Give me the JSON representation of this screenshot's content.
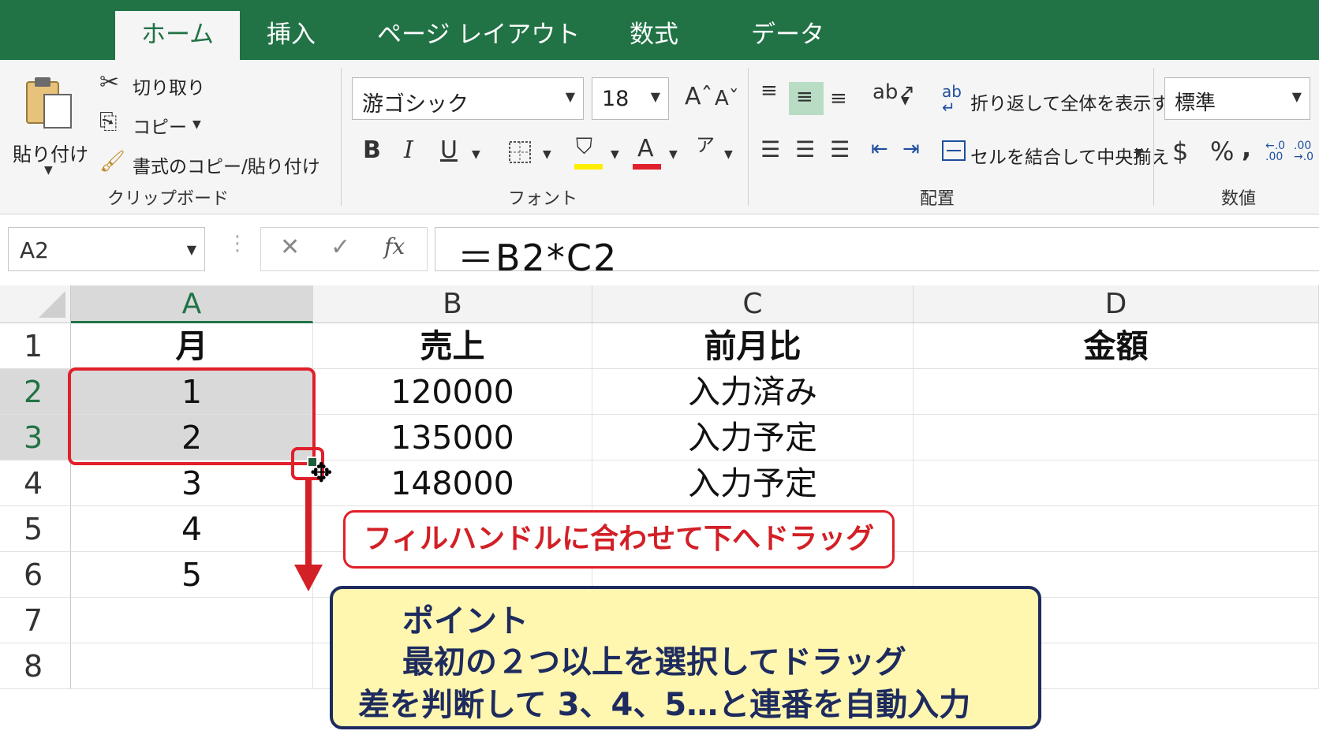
{
  "tabs": [
    {
      "label": "ホーム",
      "active": true
    },
    {
      "label": "挿入"
    },
    {
      "label": "ページ レイアウト"
    },
    {
      "label": "数式"
    },
    {
      "label": "データ"
    }
  ],
  "ribbon": {
    "clipboard": {
      "paste_label": "貼り付け",
      "cut_label": "切り取り",
      "copy_label": "コピー",
      "format_painter_label": "書式のコピー/貼り付け",
      "group_label": "クリップボード"
    },
    "font": {
      "font_name": "游ゴシック",
      "font_size": "18",
      "bold": "B",
      "italic": "I",
      "underline": "U",
      "group_label": "フォント"
    },
    "alignment": {
      "wrap_text_label": "折り返して全体を表示する",
      "merge_center_label": "セルを結合して中央揃え",
      "group_label": "配置"
    },
    "number": {
      "format": "標準",
      "currency": "$",
      "percent": "%",
      "comma": ",",
      "group_label": "数値"
    }
  },
  "formula_bar": {
    "name_box": "A2",
    "formula": "＝B2*C2",
    "fx": "fx"
  },
  "sheet": {
    "columns": [
      "A",
      "B",
      "C",
      "D"
    ],
    "selected_column": "A",
    "row_numbers": [
      "1",
      "2",
      "3",
      "4",
      "5",
      "6",
      "7",
      "8"
    ],
    "selected_rows": [
      "2",
      "3"
    ],
    "rows": [
      [
        "月",
        "売上",
        "前月比",
        "金額"
      ],
      [
        "1",
        "120000",
        "入力済み",
        ""
      ],
      [
        "2",
        "135000",
        "入力予定",
        ""
      ],
      [
        "3",
        "148000",
        "入力予定",
        ""
      ],
      [
        "4",
        "",
        "",
        ""
      ],
      [
        "5",
        "",
        "",
        ""
      ],
      [
        "",
        "",
        "",
        ""
      ],
      [
        "",
        "",
        "",
        ""
      ]
    ]
  },
  "annotations": {
    "drag_hint": "フィルハンドルに合わせて下へドラッグ",
    "tip_title": "ポイント",
    "tip_line2": "最初の２つ以上を選択してドラッグ",
    "tip_line3": "差を判断して 3、4、5…と連番を自動入力"
  },
  "colors": {
    "excel_green": "#217346",
    "annotation_red": "#d31f26",
    "tip_background": "#fff6b0",
    "tip_border": "#1d2b5e"
  }
}
